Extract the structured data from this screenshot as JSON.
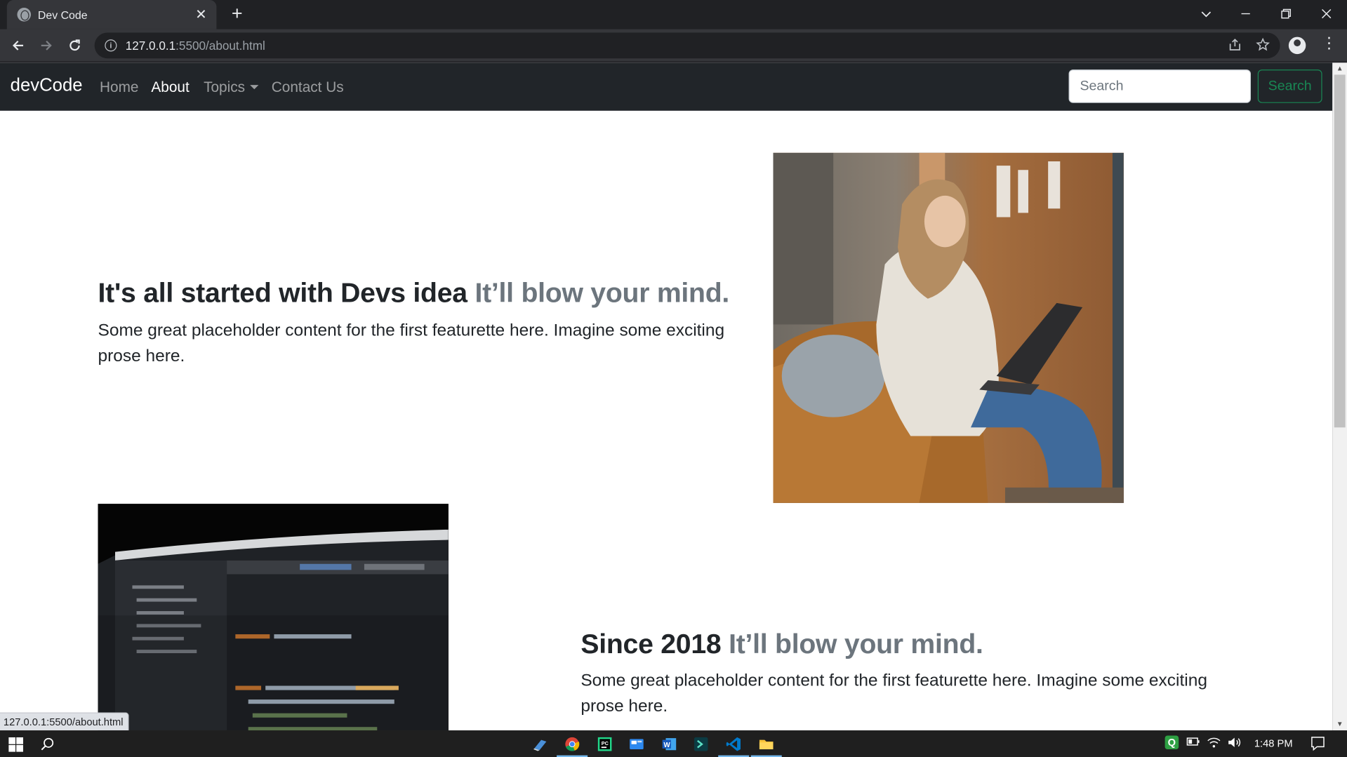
{
  "browser": {
    "tab_title": "Dev Code",
    "tab_close": "✕",
    "new_tab": "+",
    "url_host": "127.0.0.1",
    "url_path": ":5500/about.html",
    "status_url": "127.0.0.1:5500/about.html"
  },
  "navbar": {
    "brand": "devCode",
    "links": [
      "Home",
      "About",
      "Topics",
      "Contact Us"
    ],
    "active": "About",
    "search_placeholder": "Search",
    "search_button": "Search",
    "accent_color": "#198754",
    "bg_color": "#212529"
  },
  "featurettes": [
    {
      "heading": "It's all started with Devs idea",
      "heading_muted": "It’ll blow your mind.",
      "lead": "Some great placeholder content for the first featurette here. Imagine some exciting prose here.",
      "image": "woman-with-laptop-photo"
    },
    {
      "heading": "Since 2018",
      "heading_muted": "It’ll blow your mind.",
      "lead": "Some great placeholder content for the first featurette here. Imagine some exciting prose here.",
      "image": "code-editor-screen-photo"
    }
  ],
  "taskbar": {
    "clock": "1:48 PM",
    "tray_q": "Q"
  }
}
